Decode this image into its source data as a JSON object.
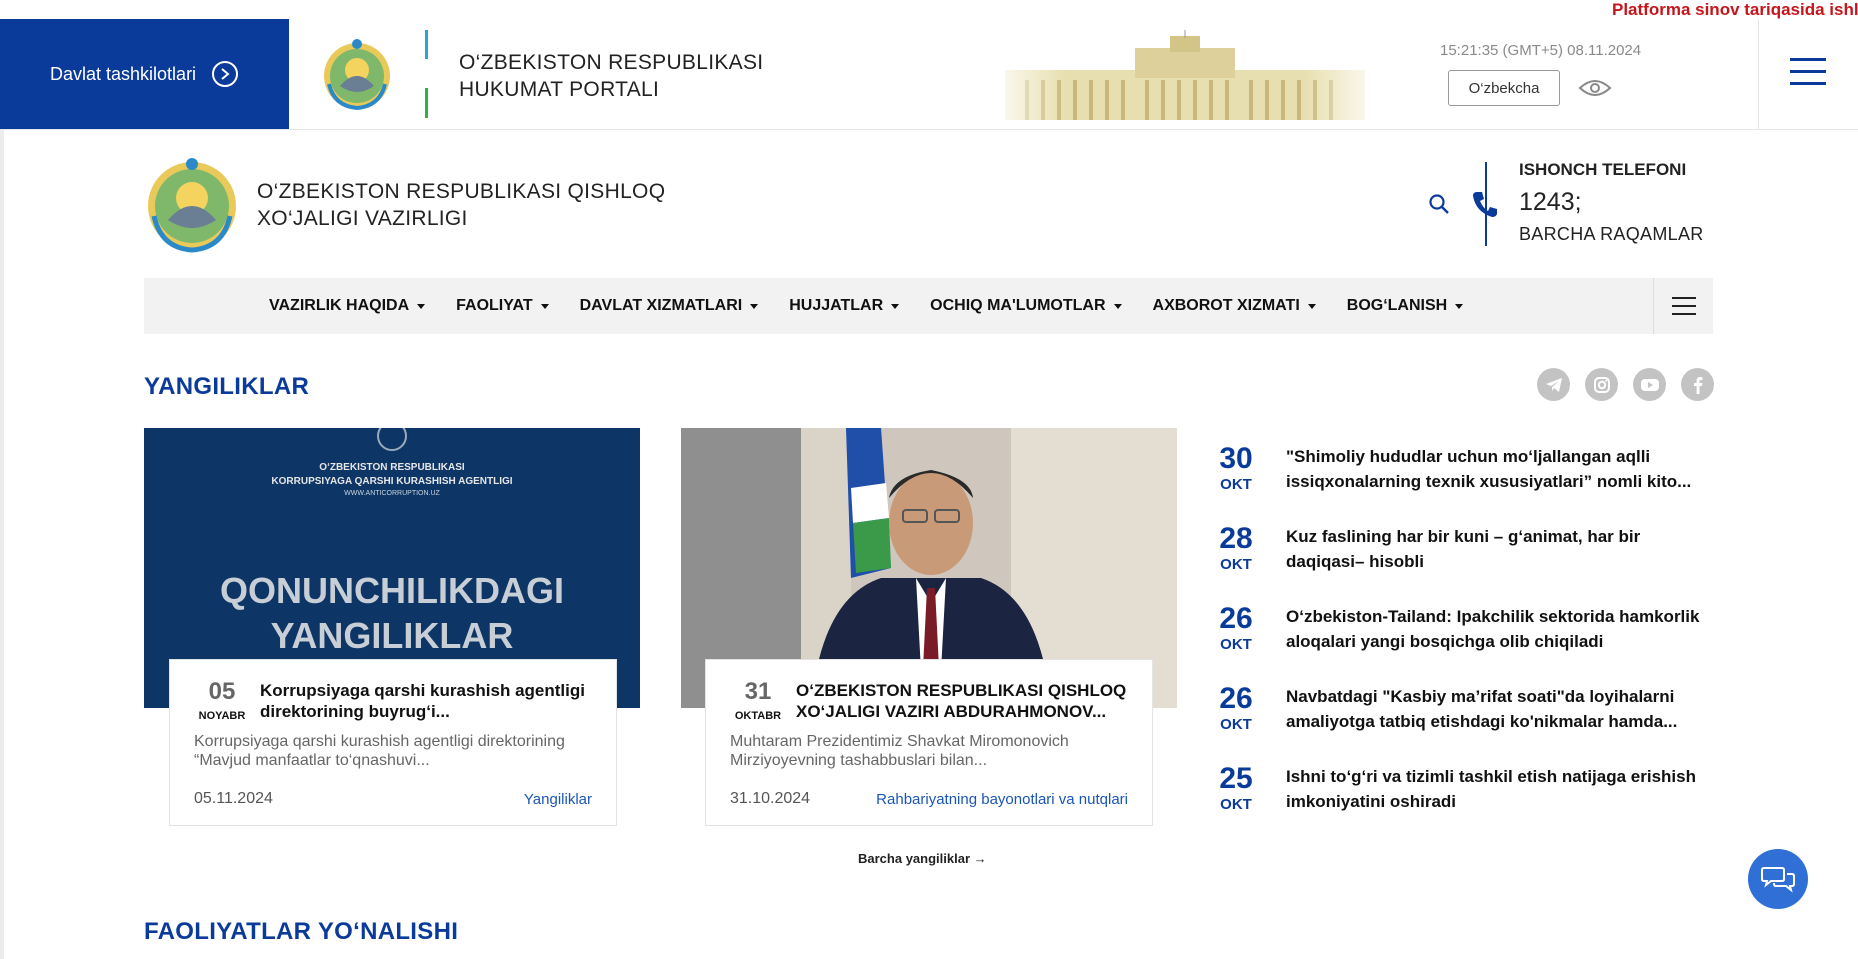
{
  "topbar": {
    "gov_button": "Davlat tashkilotlari",
    "portal_title_line1": "O‘ZBEKISTON RESPUBLIKASI",
    "portal_title_line2": "HUKUMAT PORTALI",
    "time": "15:21:35 (GMT+5) 08.11.2024",
    "language": "O‘zbekcha",
    "notice": "Platforma sinov tariqasida ishlamoqda"
  },
  "ministry": {
    "title_line1": "O‘ZBEKISTON RESPUBLIKASI QISHLOQ",
    "title_line2": "XO‘JALIGI VAZIRLIGI"
  },
  "hotline": {
    "label": "ISHONCH TELEFONI",
    "number": "1243;",
    "all_numbers": "BARCHA RAQAMLAR"
  },
  "nav": {
    "items": [
      "VAZIRLIK HAQIDA",
      "FAOLIYAT",
      "DAVLAT XIZMATLARI",
      "HUJJATLAR",
      "OCHIQ MA'LUMOTLAR",
      "AXBOROT XIZMATI",
      "BOG‘LANISH"
    ]
  },
  "news": {
    "section_title": "YANGILIKLAR",
    "cards": [
      {
        "day": "05",
        "month": "NOYABR",
        "title": "Korrupsiyaga qarshi kurashish agentligi direktorining buyrug‘i...",
        "text": "Korrupsiyaga qarshi kurashish agentligi direktorining “Mavjud manfaatlar to‘qnashuvi...",
        "date": "05.11.2024",
        "category": "Yangiliklar",
        "image_text": {
          "line1": "O‘ZBEKISTON RESPUBLIKASI",
          "line2": "KORRUPSIYAGA QARSHI KURASHISH AGENTLIGI",
          "line3": "WWW.ANTICORRUPTION.UZ",
          "big1": "QONUNCHILIKDAGI",
          "big2": "YANGILIKLAR"
        }
      },
      {
        "day": "31",
        "month": "OKTABR",
        "title": "O‘ZBEKISTON RESPUBLIKASI QISHLOQ XO‘JALIGI VAZIRI ABDURAHMONOV...",
        "text": "Muhtaram Prezidentimiz Shavkat Miromonovich Mirziyoyevning tashabbuslari bilan...",
        "date": "31.10.2024",
        "category": "Rahbariyatning bayonotlari va nutqlari"
      }
    ],
    "side": [
      {
        "day": "30",
        "month": "OKT",
        "title": "\"Shimoliy hududlar uchun mo‘ljallangan aqlli issiqxonalarning texnik xususiyatlari” nomli kito..."
      },
      {
        "day": "28",
        "month": "OKT",
        "title": "Kuz faslining har bir kuni – g‘animat, har bir daqiqasi– hisobli"
      },
      {
        "day": "26",
        "month": "OKT",
        "title": "O‘zbekiston-Tailand: Ipakchilik sektorida hamkorlik aloqalari yangi bosqichga olib chiqiladi"
      },
      {
        "day": "26",
        "month": "OKT",
        "title": "Navbatdagi \"Kasbiy ma’rifat soati\"da loyihalarni amaliyotga tatbiq etishdagi ko'nikmalar hamda..."
      },
      {
        "day": "25",
        "month": "OKT",
        "title": "Ishni to‘g‘ri va tizimli tashkil etish natijaga erishish imkoniyatini oshiradi"
      }
    ],
    "all_link": "Barcha yangiliklar →"
  },
  "activities": {
    "section_title": "FAOLIYATLAR YO‘NALISHI"
  },
  "colors": {
    "brand": "#0b3b9a",
    "accent": "#c4161c",
    "link": "#1a56b8"
  }
}
